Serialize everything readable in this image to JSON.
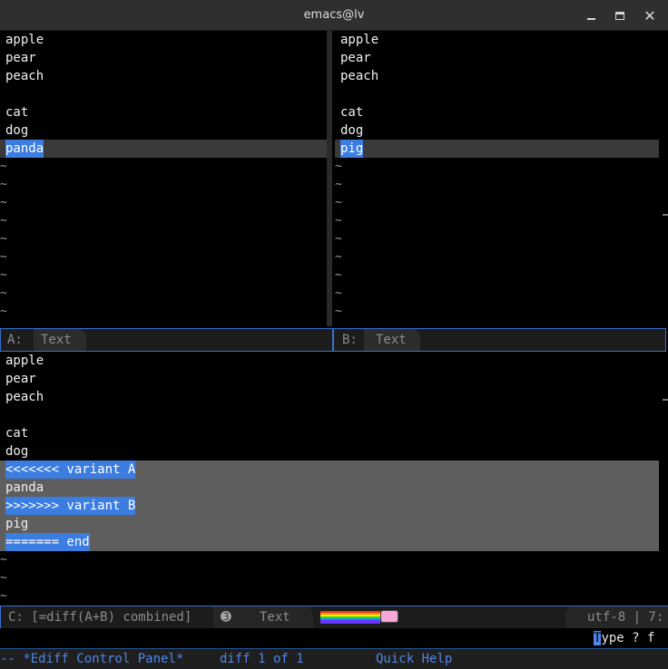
{
  "window": {
    "title": "emacs@lv",
    "minimize_label": "",
    "maximize_label": "",
    "close_label": "✕"
  },
  "buffer_a": {
    "lines": [
      "apple",
      "pear",
      "peach",
      "",
      "cat",
      "dog"
    ],
    "diff_line": "panda",
    "modeline": {
      "tag": "A:",
      "mode": "Text"
    }
  },
  "buffer_b": {
    "lines": [
      "apple",
      "pear",
      "peach",
      "",
      "cat",
      "dog"
    ],
    "diff_line": "pig",
    "modeline": {
      "tag": "B:",
      "mode": "Text"
    }
  },
  "buffer_c": {
    "lines": [
      "apple",
      "pear",
      "peach",
      "",
      "cat",
      "dog"
    ],
    "diff_block": [
      {
        "text": "<<<<<<< variant A",
        "marker": true
      },
      {
        "text": "panda",
        "marker": false
      },
      {
        "text": ">>>>>>> variant B",
        "marker": true
      },
      {
        "text": "pig",
        "marker": false
      },
      {
        "text": "======= end",
        "marker": true
      }
    ],
    "modeline": {
      "label": "C: [=diff(A+B) combined]",
      "badge": "➌",
      "mode": "Text",
      "encoding": "utf-8 | 7:"
    }
  },
  "echo_area": {
    "cursor_char": "T",
    "hint_rest": "ype ? f"
  },
  "control_panel": {
    "name": "-- *Ediff Control Panel*",
    "status": "diff 1 of 1",
    "help": "Quick Help"
  },
  "colors": {
    "selection": "#3b7de0",
    "diff_band": "#3a3a3a",
    "combined_band": "#5e5e5e",
    "modeline_border": "#3a6fd0"
  }
}
